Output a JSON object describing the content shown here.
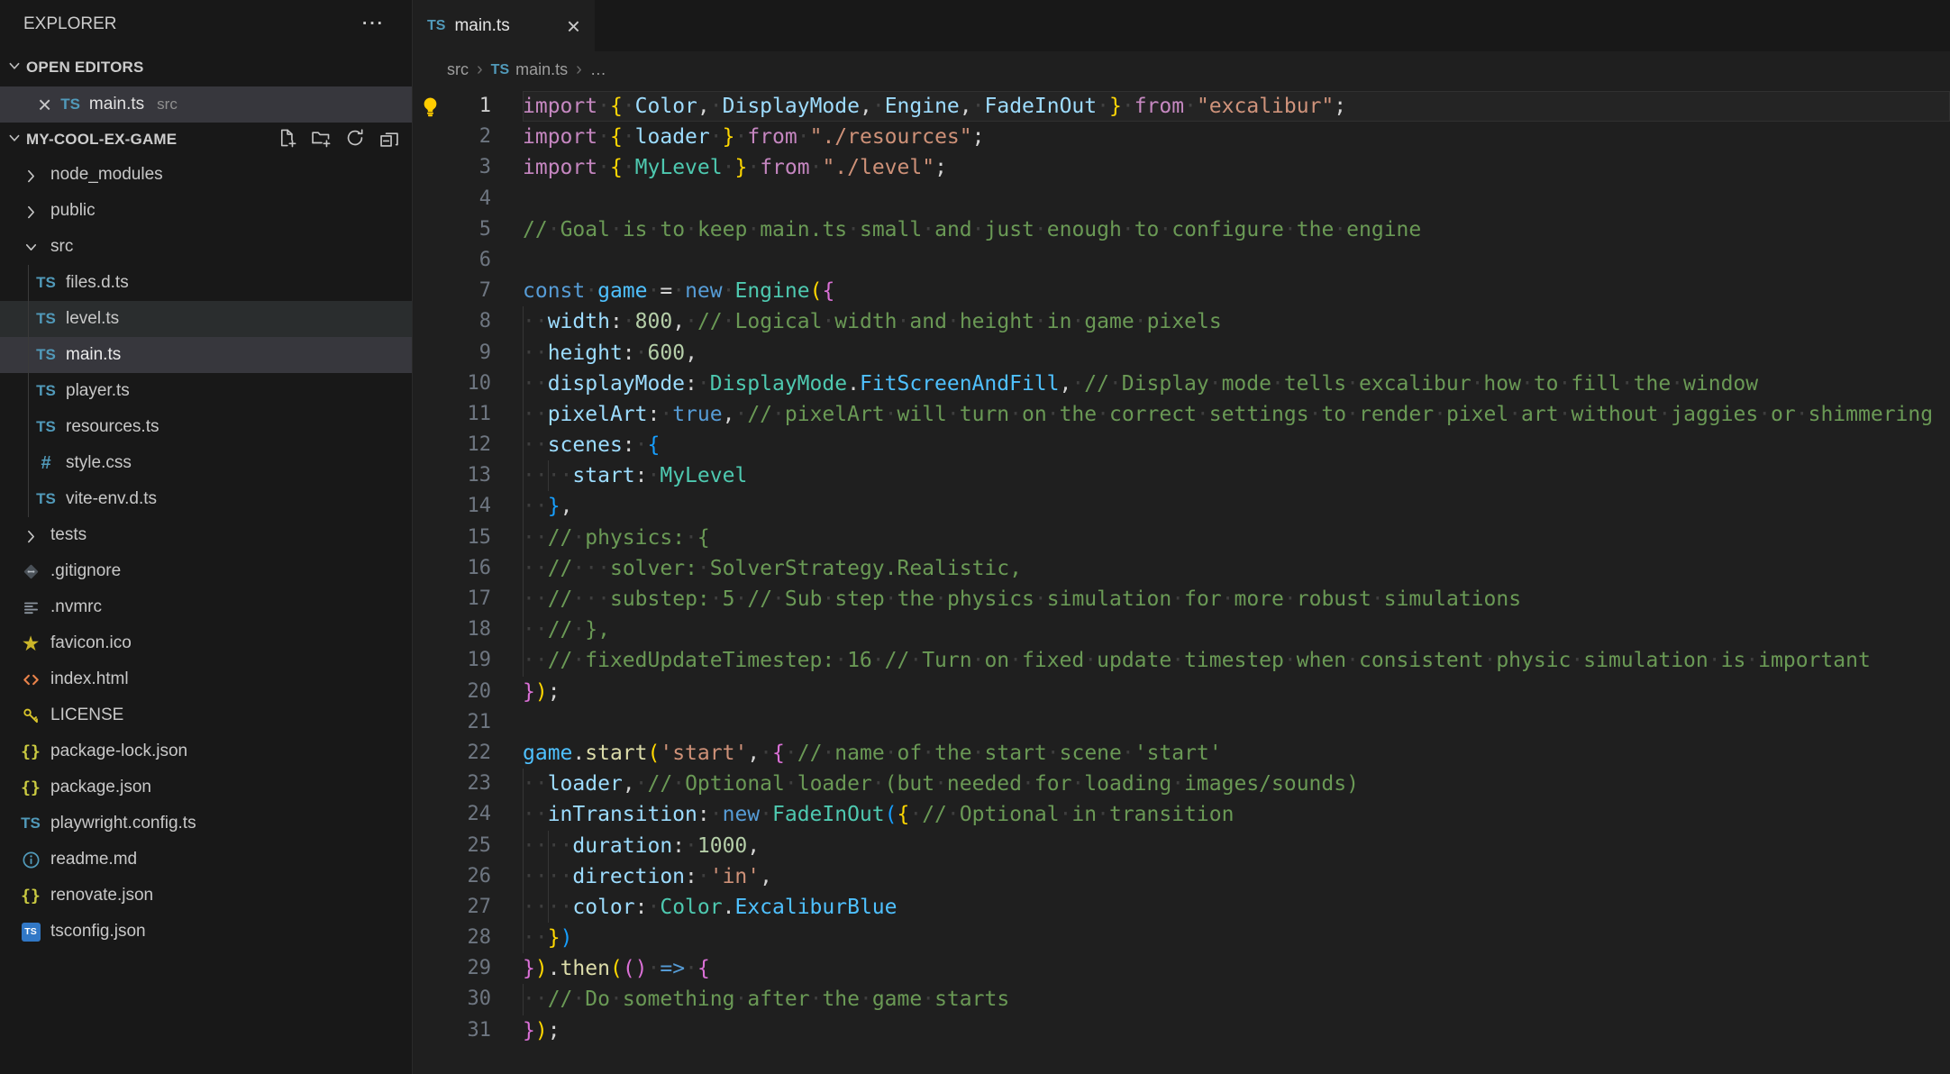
{
  "sidebar": {
    "title": "EXPLORER",
    "more_icon": "···",
    "open_editors_label": "OPEN EDITORS",
    "project_label": "MY-COOL-EX-GAME",
    "open_editor": {
      "close_icon": "×",
      "icon_text": "TS",
      "file": "main.ts",
      "dir": "src"
    },
    "toolbar": [
      "new-file",
      "new-folder",
      "refresh",
      "collapse-all"
    ],
    "tree": [
      {
        "kind": "folder",
        "label": "node_modules",
        "chevron": "right"
      },
      {
        "kind": "folder",
        "label": "public",
        "chevron": "right"
      },
      {
        "kind": "folder",
        "label": "src",
        "chevron": "down"
      },
      {
        "kind": "file",
        "icon": "ts",
        "label": "files.d.ts",
        "indent": 1
      },
      {
        "kind": "file",
        "icon": "ts",
        "label": "level.ts",
        "indent": 1,
        "state": "focused"
      },
      {
        "kind": "file",
        "icon": "ts",
        "label": "main.ts",
        "indent": 1,
        "state": "selected"
      },
      {
        "kind": "file",
        "icon": "ts",
        "label": "player.ts",
        "indent": 1
      },
      {
        "kind": "file",
        "icon": "ts",
        "label": "resources.ts",
        "indent": 1
      },
      {
        "kind": "file",
        "icon": "css",
        "label": "style.css",
        "indent": 1
      },
      {
        "kind": "file",
        "icon": "ts",
        "label": "vite-env.d.ts",
        "indent": 1
      },
      {
        "kind": "folder",
        "label": "tests",
        "chevron": "right"
      },
      {
        "kind": "file",
        "icon": "git",
        "label": ".gitignore"
      },
      {
        "kind": "file",
        "icon": "config",
        "label": ".nvmrc"
      },
      {
        "kind": "file",
        "icon": "star",
        "label": "favicon.ico"
      },
      {
        "kind": "file",
        "icon": "html",
        "label": "index.html"
      },
      {
        "kind": "file",
        "icon": "key",
        "label": "LICENSE"
      },
      {
        "kind": "file",
        "icon": "json",
        "label": "package-lock.json"
      },
      {
        "kind": "file",
        "icon": "json",
        "label": "package.json"
      },
      {
        "kind": "file",
        "icon": "ts",
        "label": "playwright.config.ts"
      },
      {
        "kind": "file",
        "icon": "info",
        "label": "readme.md"
      },
      {
        "kind": "file",
        "icon": "json",
        "label": "renovate.json"
      },
      {
        "kind": "file",
        "icon": "tsconfig",
        "label": "tsconfig.json"
      }
    ]
  },
  "editor": {
    "tab": {
      "icon_text": "TS",
      "label": "main.ts",
      "close_icon": "×"
    },
    "breadcrumb": {
      "separator": "›",
      "segments": [
        {
          "label": "src"
        },
        {
          "label": "main.ts",
          "icon_text": "TS"
        },
        {
          "label": "…"
        }
      ]
    },
    "palette": {
      "kw1": "#C586C0",
      "kw": "#569CD6",
      "id": "#9CDCFE",
      "vr": "#4FC1FF",
      "ty": "#4EC9B0",
      "en": "#4FC1FF",
      "st": "#CE9178",
      "nu": "#B5CEA8",
      "cm": "#6A9955",
      "fn": "#DCDCAA",
      "pn": "#D4D4D4",
      "b1": "#FFD700",
      "b2": "#DA70D6",
      "b3": "#179FFF",
      "ind": "#3E3E3E"
    },
    "lines": [
      {
        "n": 1,
        "bulb": true,
        "current": true,
        "tokens": [
          [
            "kw1",
            "import"
          ],
          [
            "b1",
            " {"
          ],
          [
            "id",
            " Color"
          ],
          [
            "pn",
            ","
          ],
          [
            "id",
            " DisplayMode"
          ],
          [
            "pn",
            ","
          ],
          [
            "id",
            " Engine"
          ],
          [
            "pn",
            ","
          ],
          [
            "id",
            " FadeInOut"
          ],
          [
            "b1",
            " }"
          ],
          [
            "kw1",
            " from"
          ],
          [
            "st",
            " \"excalibur\""
          ],
          [
            "pn",
            ";"
          ]
        ]
      },
      {
        "n": 2,
        "tokens": [
          [
            "kw1",
            "import"
          ],
          [
            "b1",
            " {"
          ],
          [
            "id",
            " loader"
          ],
          [
            "b1",
            " }"
          ],
          [
            "kw1",
            " from"
          ],
          [
            "st",
            " \"./resources\""
          ],
          [
            "pn",
            ";"
          ]
        ]
      },
      {
        "n": 3,
        "tokens": [
          [
            "kw1",
            "import"
          ],
          [
            "b1",
            " {"
          ],
          [
            "ty",
            " MyLevel"
          ],
          [
            "b1",
            " }"
          ],
          [
            "kw1",
            " from"
          ],
          [
            "st",
            " \"./level\""
          ],
          [
            "pn",
            ";"
          ]
        ]
      },
      {
        "n": 4,
        "tokens": []
      },
      {
        "n": 5,
        "tokens": [
          [
            "cm",
            "// Goal is to keep main.ts small and just enough to configure the engine"
          ]
        ]
      },
      {
        "n": 6,
        "tokens": []
      },
      {
        "n": 7,
        "tokens": [
          [
            "kw",
            "const"
          ],
          [
            "vr",
            " game"
          ],
          [
            "pn",
            " ="
          ],
          [
            "kw",
            " new"
          ],
          [
            "ty",
            " Engine"
          ],
          [
            "b1",
            "("
          ],
          [
            "b2",
            "{"
          ]
        ]
      },
      {
        "n": 8,
        "tokens": [
          [
            "ind",
            "  "
          ],
          [
            "id",
            "width"
          ],
          [
            "pn",
            ":"
          ],
          [
            "nu",
            " 800"
          ],
          [
            "pn",
            ","
          ],
          [
            "cm",
            " // Logical width and height in game pixels"
          ]
        ]
      },
      {
        "n": 9,
        "tokens": [
          [
            "ind",
            "  "
          ],
          [
            "id",
            "height"
          ],
          [
            "pn",
            ":"
          ],
          [
            "nu",
            " 600"
          ],
          [
            "pn",
            ","
          ]
        ]
      },
      {
        "n": 10,
        "tokens": [
          [
            "ind",
            "  "
          ],
          [
            "id",
            "displayMode"
          ],
          [
            "pn",
            ":"
          ],
          [
            "ty",
            " DisplayMode"
          ],
          [
            "pn",
            "."
          ],
          [
            "en",
            "FitScreenAndFill"
          ],
          [
            "pn",
            ","
          ],
          [
            "cm",
            " // Display mode tells excalibur how to fill the window"
          ]
        ]
      },
      {
        "n": 11,
        "tokens": [
          [
            "ind",
            "  "
          ],
          [
            "id",
            "pixelArt"
          ],
          [
            "pn",
            ":"
          ],
          [
            "kw",
            " true"
          ],
          [
            "pn",
            ","
          ],
          [
            "cm",
            " // pixelArt will turn on the correct settings to render pixel art without jaggies or shimmering"
          ]
        ]
      },
      {
        "n": 12,
        "tokens": [
          [
            "ind",
            "  "
          ],
          [
            "id",
            "scenes"
          ],
          [
            "pn",
            ":"
          ],
          [
            "b3",
            " {"
          ]
        ]
      },
      {
        "n": 13,
        "tokens": [
          [
            "ind",
            "    "
          ],
          [
            "id",
            "start"
          ],
          [
            "pn",
            ":"
          ],
          [
            "ty",
            " MyLevel"
          ]
        ]
      },
      {
        "n": 14,
        "tokens": [
          [
            "ind",
            "  "
          ],
          [
            "b3",
            "}"
          ],
          [
            "pn",
            ","
          ]
        ]
      },
      {
        "n": 15,
        "tokens": [
          [
            "ind",
            "  "
          ],
          [
            "cm",
            "// physics: {"
          ]
        ]
      },
      {
        "n": 16,
        "tokens": [
          [
            "ind",
            "  "
          ],
          [
            "cm",
            "//   solver: SolverStrategy.Realistic,"
          ]
        ]
      },
      {
        "n": 17,
        "tokens": [
          [
            "ind",
            "  "
          ],
          [
            "cm",
            "//   substep: 5 // Sub step the physics simulation for more robust simulations"
          ]
        ]
      },
      {
        "n": 18,
        "tokens": [
          [
            "ind",
            "  "
          ],
          [
            "cm",
            "// },"
          ]
        ]
      },
      {
        "n": 19,
        "tokens": [
          [
            "ind",
            "  "
          ],
          [
            "cm",
            "// fixedUpdateTimestep: 16 // Turn on fixed update timestep when consistent physic simulation is important"
          ]
        ]
      },
      {
        "n": 20,
        "tokens": [
          [
            "b2",
            "}"
          ],
          [
            "b1",
            ")"
          ],
          [
            "pn",
            ";"
          ]
        ]
      },
      {
        "n": 21,
        "tokens": []
      },
      {
        "n": 22,
        "tokens": [
          [
            "vr",
            "game"
          ],
          [
            "pn",
            "."
          ],
          [
            "fn",
            "start"
          ],
          [
            "b1",
            "("
          ],
          [
            "st",
            "'start'"
          ],
          [
            "pn",
            ","
          ],
          [
            "b2",
            " {"
          ],
          [
            "cm",
            " // name of the start scene 'start'"
          ]
        ]
      },
      {
        "n": 23,
        "tokens": [
          [
            "ind",
            "  "
          ],
          [
            "id",
            "loader"
          ],
          [
            "pn",
            ","
          ],
          [
            "cm",
            " // Optional loader (but needed for loading images/sounds)"
          ]
        ]
      },
      {
        "n": 24,
        "tokens": [
          [
            "ind",
            "  "
          ],
          [
            "id",
            "inTransition"
          ],
          [
            "pn",
            ":"
          ],
          [
            "kw",
            " new"
          ],
          [
            "ty",
            " FadeInOut"
          ],
          [
            "b3",
            "("
          ],
          [
            "b1",
            "{"
          ],
          [
            "cm",
            " // Optional in transition"
          ]
        ]
      },
      {
        "n": 25,
        "tokens": [
          [
            "ind",
            "    "
          ],
          [
            "id",
            "duration"
          ],
          [
            "pn",
            ":"
          ],
          [
            "nu",
            " 1000"
          ],
          [
            "pn",
            ","
          ]
        ]
      },
      {
        "n": 26,
        "tokens": [
          [
            "ind",
            "    "
          ],
          [
            "id",
            "direction"
          ],
          [
            "pn",
            ":"
          ],
          [
            "st",
            " 'in'"
          ],
          [
            "pn",
            ","
          ]
        ]
      },
      {
        "n": 27,
        "tokens": [
          [
            "ind",
            "    "
          ],
          [
            "id",
            "color"
          ],
          [
            "pn",
            ":"
          ],
          [
            "ty",
            " Color"
          ],
          [
            "pn",
            "."
          ],
          [
            "en",
            "ExcaliburBlue"
          ]
        ]
      },
      {
        "n": 28,
        "tokens": [
          [
            "ind",
            "  "
          ],
          [
            "b1",
            "}"
          ],
          [
            "b3",
            ")"
          ]
        ]
      },
      {
        "n": 29,
        "tokens": [
          [
            "b2",
            "}"
          ],
          [
            "b1",
            ")"
          ],
          [
            "pn",
            "."
          ],
          [
            "fn",
            "then"
          ],
          [
            "b1",
            "("
          ],
          [
            "b2",
            "()"
          ],
          [
            "kw",
            " =>"
          ],
          [
            "b2",
            " {"
          ]
        ]
      },
      {
        "n": 30,
        "tokens": [
          [
            "ind",
            "  "
          ],
          [
            "cm",
            "// Do something after the game starts"
          ]
        ]
      },
      {
        "n": 31,
        "tokens": [
          [
            "b2",
            "}"
          ],
          [
            "b1",
            ")"
          ],
          [
            "pn",
            ";"
          ]
        ]
      }
    ]
  }
}
